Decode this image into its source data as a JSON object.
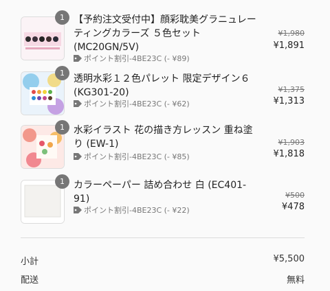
{
  "items": [
    {
      "qty": "1",
      "name": "【予約注文受付中】顔彩耽美グラニュレーティングカラーズ ５色セット (MC20GN/5V)",
      "discount": "ポイント割引-4BE23C (- ¥89)",
      "old_price": "¥1,980",
      "price": "¥1,891",
      "icon": "tag-icon"
    },
    {
      "qty": "1",
      "name": "透明水彩１２色パレット 限定デザイン６ (KG301-20)",
      "discount": "ポイント割引-4BE23C (- ¥62)",
      "old_price": "¥1,375",
      "price": "¥1,313",
      "icon": "tag-icon"
    },
    {
      "qty": "1",
      "name": "水彩イラスト 花の描き方レッスン 重ね塗り (EW-1)",
      "discount": "ポイント割引-4BE23C (- ¥85)",
      "old_price": "¥1,903",
      "price": "¥1,818",
      "icon": "tag-icon"
    },
    {
      "qty": "1",
      "name": "カラーペーパー 詰め合わせ 白 (EC401-91)",
      "discount": "ポイント割引-4BE23C (- ¥22)",
      "old_price": "¥500",
      "price": "¥478",
      "icon": "tag-icon"
    }
  ],
  "summary": {
    "subtotal_label": "小計",
    "subtotal_value": "¥5,500",
    "shipping_label": "配送",
    "shipping_value": "無料"
  }
}
